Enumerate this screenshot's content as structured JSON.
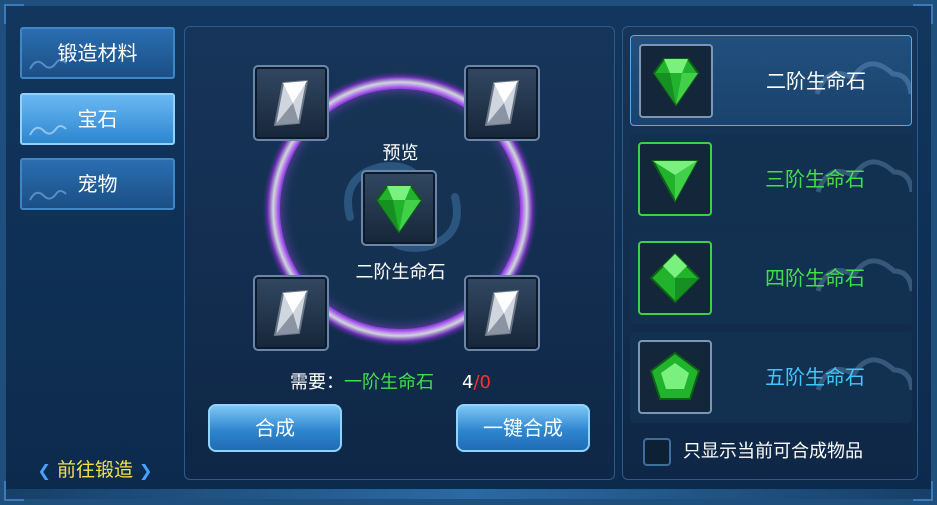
{
  "tabs": [
    {
      "label": "锻造材料",
      "active": false
    },
    {
      "label": "宝石",
      "active": true
    },
    {
      "label": "宠物",
      "active": false
    }
  ],
  "goto_forge": "前往锻造",
  "preview_label": "预览",
  "preview_item": "二阶生命石",
  "requirement": {
    "prefix": "需要：",
    "item": "一阶生命石",
    "have": "4",
    "slash": "/",
    "need": "0"
  },
  "buttons": {
    "combine": "合成",
    "combine_all": "一键合成"
  },
  "list": [
    {
      "name": "二阶生命石",
      "color": "#ffffff",
      "selected": true,
      "icon": "gem-tier2-icon"
    },
    {
      "name": "三阶生命石",
      "color": "#3fe04a",
      "selected": false,
      "icon": "gem-tier3-icon"
    },
    {
      "name": "四阶生命石",
      "color": "#3fe04a",
      "selected": false,
      "icon": "gem-tier4-icon"
    },
    {
      "name": "五阶生命石",
      "color": "#3fc8ff",
      "selected": false,
      "icon": "gem-tier5-icon"
    }
  ],
  "filter_label": "只显示当前可合成物品",
  "colors": {
    "accent": "#2e86d0",
    "gem_green": "#3fe04a",
    "ring_purple": "#b04cff"
  }
}
